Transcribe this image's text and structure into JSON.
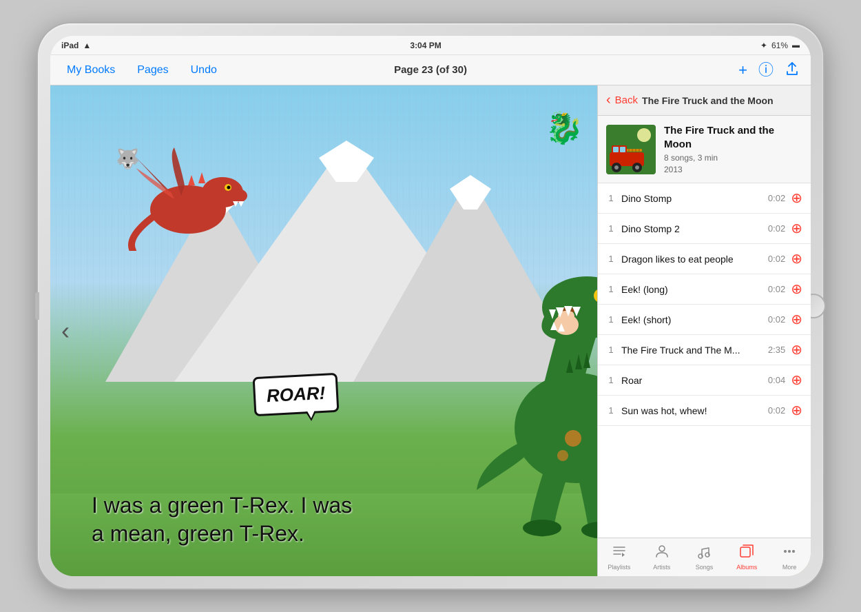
{
  "device": {
    "status_bar": {
      "device_name": "iPad",
      "wifi_icon": "wifi",
      "time": "3:04 PM",
      "bluetooth_icon": "bluetooth",
      "battery_percent": "61%",
      "battery_icon": "battery"
    },
    "toolbar": {
      "my_books_label": "My Books",
      "pages_label": "Pages",
      "undo_label": "Undo",
      "page_info": "Page 23 (of 30)",
      "add_icon": "+",
      "info_icon": "ℹ",
      "share_icon": "share"
    }
  },
  "book": {
    "text": "I was a green T-Rex. I was a mean, green T-Rex.",
    "roar_text": "ROAR!",
    "nav_left": "‹",
    "nav_right": "›"
  },
  "music_panel": {
    "header": {
      "back_label": "Back",
      "title": "The Fire Truck and the Moon"
    },
    "album": {
      "title": "The Fire Truck and the Moon",
      "meta_line1": "8 songs, 3 min",
      "meta_line2": "2013"
    },
    "songs": [
      {
        "track": "1",
        "name": "Dino Stomp",
        "duration": "0:02"
      },
      {
        "track": "1",
        "name": "Dino Stomp 2",
        "duration": "0:02"
      },
      {
        "track": "1",
        "name": "Dragon likes to eat people",
        "duration": "0:02"
      },
      {
        "track": "1",
        "name": "Eek! (long)",
        "duration": "0:02"
      },
      {
        "track": "1",
        "name": "Eek! (short)",
        "duration": "0:02"
      },
      {
        "track": "1",
        "name": "The Fire Truck and The M...",
        "duration": "2:35"
      },
      {
        "track": "1",
        "name": "Roar",
        "duration": "0:04"
      },
      {
        "track": "1",
        "name": "Sun was hot, whew!",
        "duration": "0:02"
      }
    ],
    "tab_bar": {
      "tabs": [
        {
          "id": "playlists",
          "label": "Playlists",
          "icon": "♫",
          "active": false
        },
        {
          "id": "artists",
          "label": "Artists",
          "icon": "👤",
          "active": false
        },
        {
          "id": "songs",
          "label": "Songs",
          "icon": "♪",
          "active": false
        },
        {
          "id": "albums",
          "label": "Albums",
          "icon": "♫",
          "active": true
        },
        {
          "id": "more",
          "label": "More",
          "icon": "•••",
          "active": false
        }
      ]
    }
  },
  "colors": {
    "accent": "#FF3B30",
    "ios_blue": "#007AFF",
    "active_tab": "#FF3B30"
  }
}
